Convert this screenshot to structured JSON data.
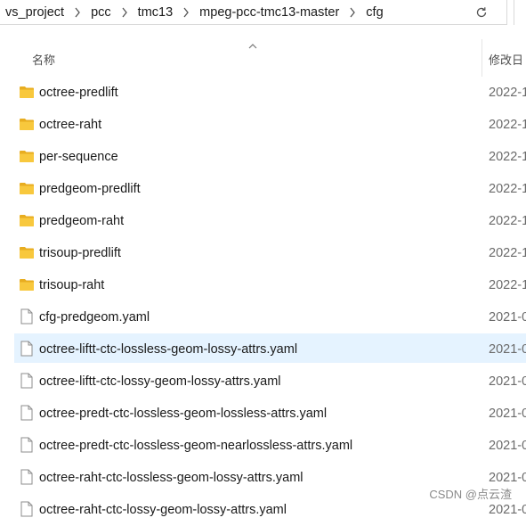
{
  "breadcrumb": [
    "vs_project",
    "pcc",
    "tmc13",
    "mpeg-pcc-tmc13-master",
    "cfg"
  ],
  "header": {
    "name_label": "名称",
    "date_label": "修改日"
  },
  "rows": [
    {
      "type": "folder",
      "name": "octree-predlift",
      "date": "2022-1"
    },
    {
      "type": "folder",
      "name": "octree-raht",
      "date": "2022-1"
    },
    {
      "type": "folder",
      "name": "per-sequence",
      "date": "2022-1"
    },
    {
      "type": "folder",
      "name": "predgeom-predlift",
      "date": "2022-1"
    },
    {
      "type": "folder",
      "name": "predgeom-raht",
      "date": "2022-1"
    },
    {
      "type": "folder",
      "name": "trisoup-predlift",
      "date": "2022-1"
    },
    {
      "type": "folder",
      "name": "trisoup-raht",
      "date": "2022-1"
    },
    {
      "type": "file",
      "name": "cfg-predgeom.yaml",
      "date": "2021-0"
    },
    {
      "type": "file",
      "name": "octree-liftt-ctc-lossless-geom-lossy-attrs.yaml",
      "date": "2021-0",
      "selected": true
    },
    {
      "type": "file",
      "name": "octree-liftt-ctc-lossy-geom-lossy-attrs.yaml",
      "date": "2021-0"
    },
    {
      "type": "file",
      "name": "octree-predt-ctc-lossless-geom-lossless-attrs.yaml",
      "date": "2021-0"
    },
    {
      "type": "file",
      "name": "octree-predt-ctc-lossless-geom-nearlossless-attrs.yaml",
      "date": "2021-0"
    },
    {
      "type": "file",
      "name": "octree-raht-ctc-lossless-geom-lossy-attrs.yaml",
      "date": "2021-0"
    },
    {
      "type": "file",
      "name": "octree-raht-ctc-lossy-geom-lossy-attrs.yaml",
      "date": "2021-0"
    }
  ],
  "watermark": "CSDN @点云渣",
  "colors": {
    "folder": "#f8c83d",
    "selection": "#e5f3ff"
  }
}
